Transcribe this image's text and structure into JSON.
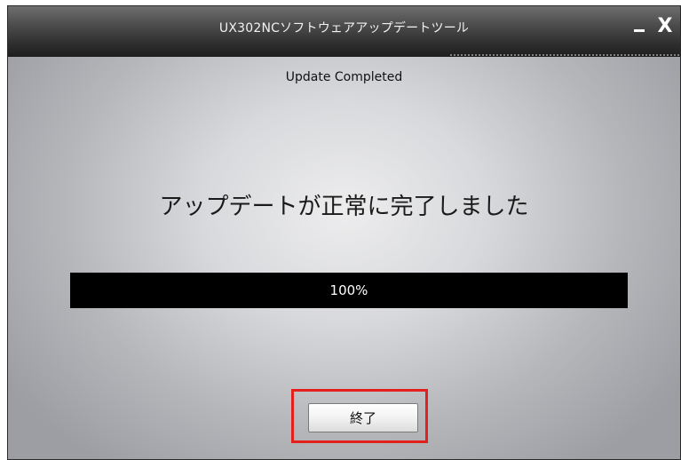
{
  "window": {
    "title": "UX302NCソフトウェアアップデートツール",
    "minimize_label": "_",
    "close_label": "X"
  },
  "status": {
    "heading": "Update Completed",
    "message": "アップデートが正常に完了しました"
  },
  "progress": {
    "value": 1.0,
    "label": "100%"
  },
  "actions": {
    "finish_label": "終了"
  },
  "colors": {
    "highlight": "#e3201b",
    "progress_bar": "#000000"
  }
}
